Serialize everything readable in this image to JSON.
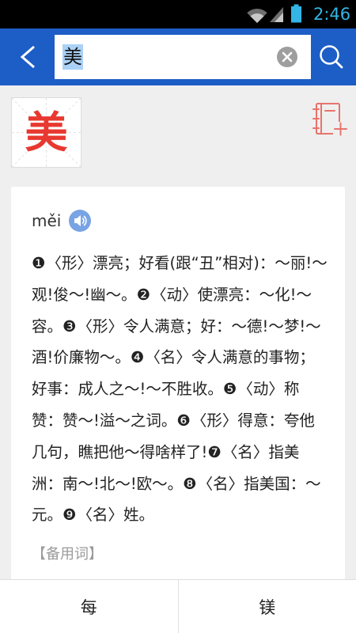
{
  "theme": {
    "brand_blue": "#1d5dc6",
    "status_accent": "#33b5e5",
    "character_red": "#e8382f",
    "notebook_icon_color": "#e8736c",
    "speaker_blue": "#78a3e4",
    "page_background": "#efefef"
  },
  "status_bar": {
    "time": "2:46",
    "icons": {
      "wifi": "wifi-icon",
      "signal": "signal-icon",
      "battery": "battery-icon"
    }
  },
  "header": {
    "back_icon": "back-arrow-icon",
    "search": {
      "value": "美",
      "clear_icon": "clear-icon"
    },
    "search_icon": "search-icon"
  },
  "character_card": {
    "glyph": "美",
    "add_to_notebook_icon": "add-to-notebook-icon"
  },
  "entry": {
    "pinyin": "měi",
    "speaker_icon": "speaker-icon",
    "definitions": [
      {
        "num": "❶",
        "pos": "〈形〉",
        "text": "漂亮；好看(跟“丑”相对)：～丽!～观!俊～!幽～。"
      },
      {
        "num": "❷",
        "pos": "〈动〉",
        "text": "使漂亮：～化!～容。"
      },
      {
        "num": "❸",
        "pos": "〈形〉",
        "text": "令人满意；好：～德!～梦!～酒!价廉物～。"
      },
      {
        "num": "❹",
        "pos": "〈名〉",
        "text": "令人满意的事物；好事：成人之～!～不胜收。"
      },
      {
        "num": "❺",
        "pos": "〈动〉",
        "text": "称赞：赞～!溢～之词。"
      },
      {
        "num": "❻",
        "pos": "〈形〉",
        "text": "得意：夸他几句，瞧把他～得啥样了!"
      },
      {
        "num": "❼",
        "pos": "〈名〉",
        "text": "指美洲：南～!北～!欧～。"
      },
      {
        "num": "❽",
        "pos": "〈名〉",
        "text": "指美国：～元。"
      },
      {
        "num": "❾",
        "pos": "〈名〉",
        "text": "姓。"
      }
    ],
    "related_words_label": "【备用词】"
  },
  "bottom_nav": {
    "prev_char": "每",
    "next_char": "镁"
  }
}
